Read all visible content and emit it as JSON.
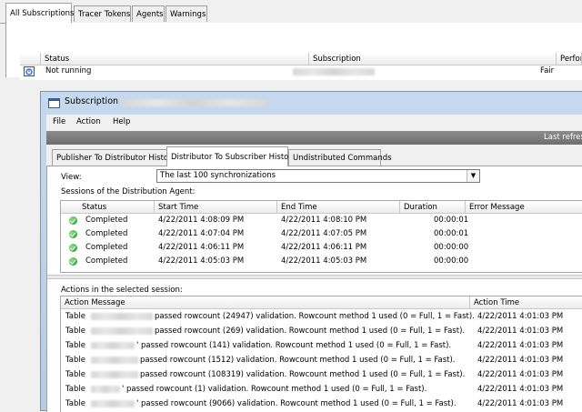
{
  "main_tabs": [
    "All Subscriptions",
    "Tracer Tokens",
    "Agents",
    "Warnings"
  ],
  "subscriptions_grid": {
    "columns": [
      "Status",
      "Subscription",
      "Performance"
    ],
    "row": {
      "icon": "subscription-status-icon",
      "status": "Not running",
      "performance": "Fair"
    }
  },
  "window": {
    "title": "Subscription",
    "menu": [
      "File",
      "Action",
      "Help"
    ],
    "refresh_label": "Last refres",
    "tabs": [
      "Publisher To Distributor History",
      "Distributor To Subscriber History",
      "Undistributed Commands"
    ],
    "view_label": "View:",
    "view_value": "The last 100 synchronizations",
    "sessions_label": "Sessions of the Distribution Agent:",
    "sessions_columns": [
      "Status",
      "Start Time",
      "End Time",
      "Duration",
      "Error Message"
    ],
    "sessions": [
      {
        "status": "Completed",
        "start": "4/22/2011 4:08:09 PM",
        "end": "4/22/2011 4:08:10 PM",
        "duration": "00:00:01"
      },
      {
        "status": "Completed",
        "start": "4/22/2011 4:07:04 PM",
        "end": "4/22/2011 4:07:05 PM",
        "duration": "00:00:01"
      },
      {
        "status": "Completed",
        "start": "4/22/2011 4:06:11 PM",
        "end": "4/22/2011 4:06:11 PM",
        "duration": "00:00:00"
      },
      {
        "status": "Completed",
        "start": "4/22/2011 4:05:03 PM",
        "end": "4/22/2011 4:05:03 PM",
        "duration": "00:00:00"
      }
    ],
    "actions_label": "Actions in the selected session:",
    "actions_columns": [
      "Action Message",
      "Action Time"
    ],
    "actions": [
      {
        "prefix": "Table",
        "message": "passed rowcount (24947) validation. Rowcount method 1 used (0 = Full, 1 = Fast).",
        "time": "4/22/2011 4:01:03 PM"
      },
      {
        "prefix": "Table",
        "message": "passed rowcount (269) validation. Rowcount method 1 used (0 = Full, 1 = Fast).",
        "time": "4/22/2011 4:01:03 PM"
      },
      {
        "prefix": "Table",
        "message": "' passed rowcount (141) validation. Rowcount method 1 used (0 = Full, 1 = Fast).",
        "time": "4/22/2011 4:01:03 PM"
      },
      {
        "prefix": "Table",
        "message": "passed rowcount (1512) validation. Rowcount method 1 used (0 = Full, 1 = Fast).",
        "time": "4/22/2011 4:01:03 PM"
      },
      {
        "prefix": "Table",
        "message": "passed rowcount (108319) validation. Rowcount method 1 used (0 = Full, 1 = Fast).",
        "time": "4/22/2011 4:01:03 PM"
      },
      {
        "prefix": "Table",
        "message": "' passed rowcount (1) validation. Rowcount method 1 used (0 = Full, 1 = Fast).",
        "time": "4/22/2011 4:01:03 PM"
      },
      {
        "prefix": "Table",
        "message": "' passed rowcount (9066) validation. Rowcount method 1 used (0 = Full, 1 = Fast).",
        "time": "4/22/2011 4:01:03 PM"
      }
    ]
  }
}
